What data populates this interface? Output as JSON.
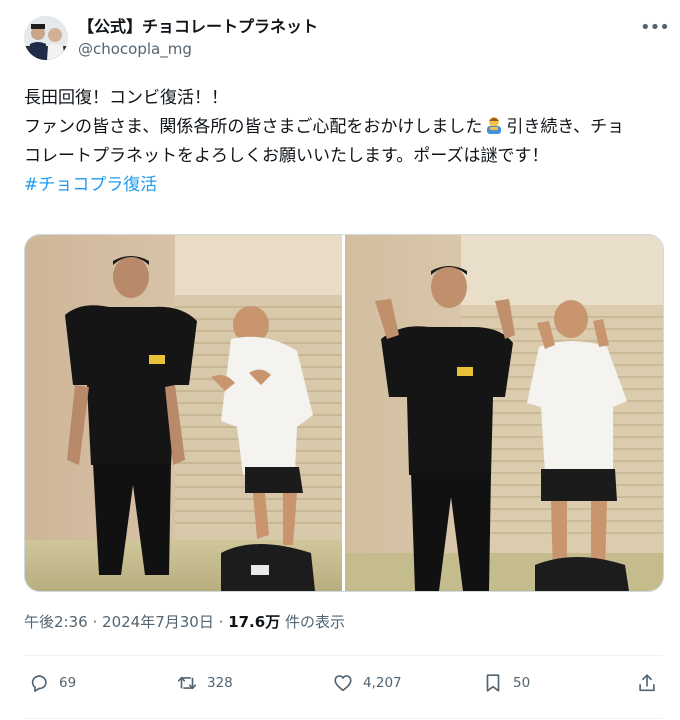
{
  "post": {
    "display_name": "【公式】チョコレートプラネット",
    "handle": "@chocopla_mg",
    "more_label": "•••",
    "text_line1": "長田回復！コンビ復活！！",
    "text_line2_a": "ファンの皆さま、関係各所の皆さまご心配をおかけしました",
    "text_line2_b": "引き続き、チョコレートプラネットをよろしくお願いいたします。ポーズは謎です！",
    "inline_emoji": "bowing-person-emoji",
    "hashtag": "#チョコプラ復活"
  },
  "meta": {
    "time": "午後2:36",
    "separator": "·",
    "date": "2024年7月30日",
    "views_count": "17.6万",
    "views_label": "件の表示"
  },
  "actions": {
    "replies": "69",
    "reposts": "328",
    "likes": "4,207",
    "bookmarks": "50"
  },
  "icons": {
    "reply": "speech-bubble-icon",
    "repost": "repost-arrows-icon",
    "like": "heart-icon",
    "bookmark": "bookmark-icon",
    "share": "share-upload-icon"
  },
  "colors": {
    "text": "#0f1419",
    "secondary": "#536471",
    "link": "#1d9bf0",
    "border": "#cfd9de"
  }
}
